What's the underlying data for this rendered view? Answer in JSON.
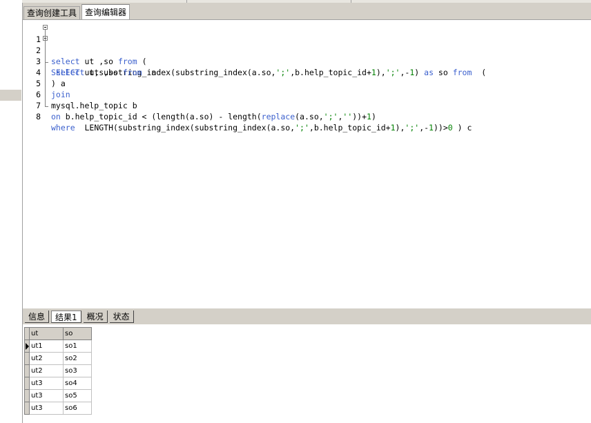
{
  "top_tabs": [
    {
      "label": "查询创建工具"
    },
    {
      "label": "查询编辑器"
    }
  ],
  "editor": {
    "lines": [
      {
        "num": "1"
      },
      {
        "num": "2"
      },
      {
        "num": "3"
      },
      {
        "num": "4"
      },
      {
        "num": "5"
      },
      {
        "num": "6"
      },
      {
        "num": "7"
      },
      {
        "num": "8"
      }
    ],
    "code": [
      "select ut ,so from (",
      "SELECT ut,substring_index(substring_index(a.so,';',b.help_topic_id+1),';',-1) as so from  (",
      " select ut ,so from  a",
      ") a",
      "join",
      "mysql.help_topic b",
      "on b.help_topic_id < (length(a.so) - length(replace(a.so,';',''))+1)",
      "where  LENGTH(substring_index(substring_index(a.so,';',b.help_topic_id+1),';',-1))>0 ) c"
    ]
  },
  "bottom_tabs": [
    {
      "label": "信息"
    },
    {
      "label": "结果1"
    },
    {
      "label": "概况"
    },
    {
      "label": "状态"
    }
  ],
  "results": {
    "columns": [
      "ut",
      "so"
    ],
    "rows": [
      [
        "ut1",
        "so1"
      ],
      [
        "ut2",
        "so2"
      ],
      [
        "ut2",
        "so3"
      ],
      [
        "ut3",
        "so4"
      ],
      [
        "ut3",
        "so5"
      ],
      [
        "ut3",
        "so6"
      ]
    ]
  }
}
